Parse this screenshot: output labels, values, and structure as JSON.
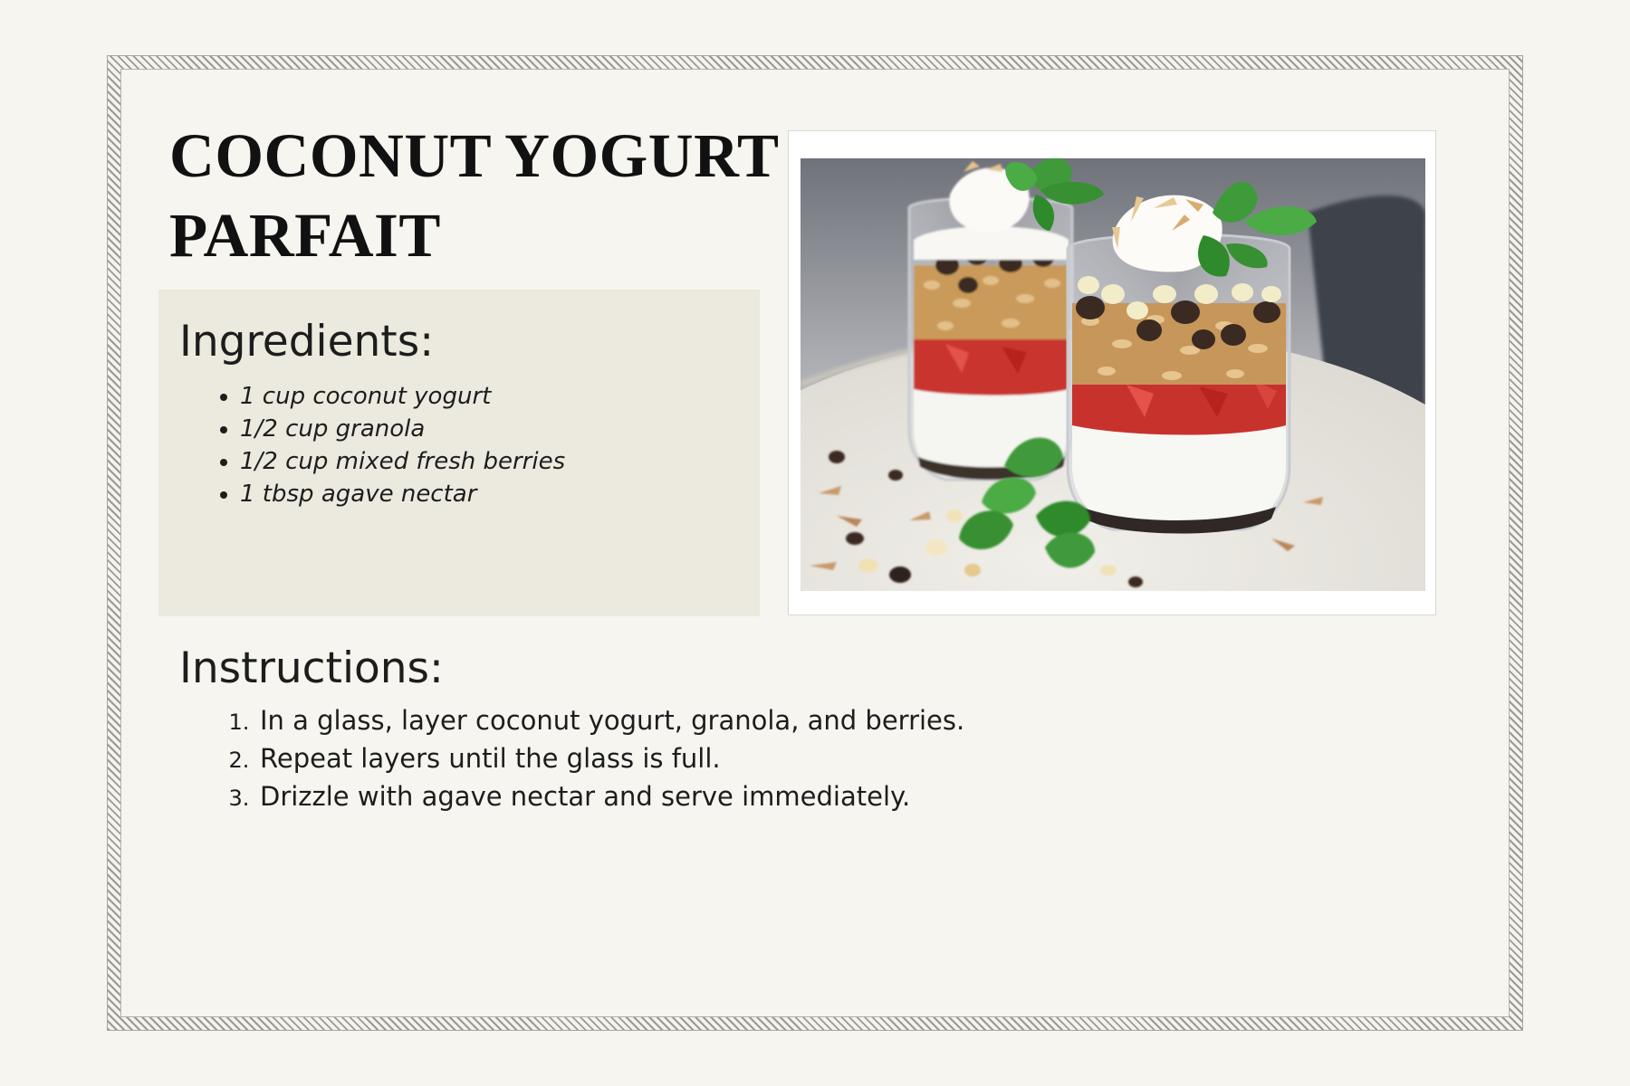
{
  "recipe": {
    "title_lines": [
      "COCONUT YOGURT",
      "PARFAIT"
    ],
    "ingredients": {
      "heading": "Ingredients:",
      "items": [
        "1 cup coconut yogurt",
        "1/2 cup granola",
        "1/2 cup mixed fresh berries",
        "1 tbsp agave nectar"
      ]
    },
    "instructions": {
      "heading": "Instructions:",
      "steps": [
        "In a glass, layer coconut yogurt, granola, and berries.",
        "Repeat layers until the glass is full.",
        "Drizzle with agave nectar and serve immediately."
      ]
    },
    "photo": {
      "subject": "two glasses of coconut yogurt parfait with granola, strawberries, chocolate chips and mint"
    }
  },
  "colors": {
    "page_background": "#f6f5f0",
    "ingredients_panel": "#eceadf",
    "text": "#1d1d1d",
    "title": "#111111",
    "border_stripe": "#9a9a94"
  }
}
